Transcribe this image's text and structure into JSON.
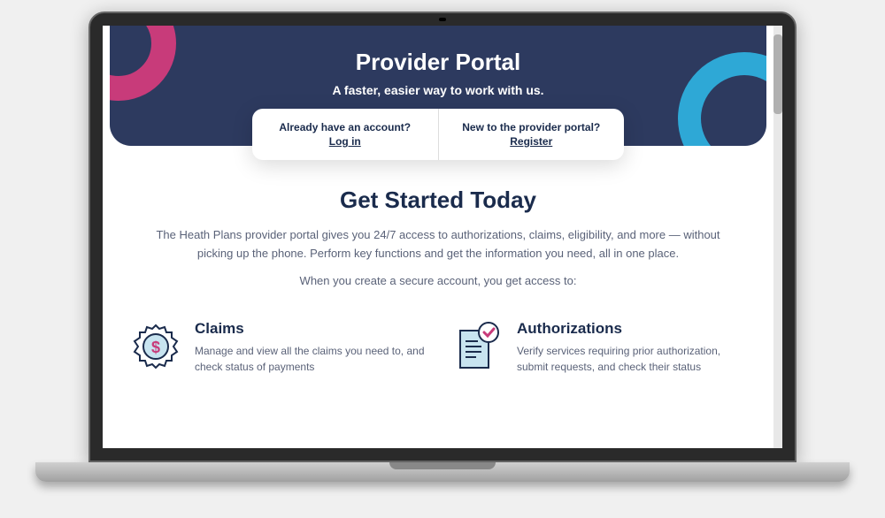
{
  "hero": {
    "title": "Provider Portal",
    "subtitle": "A faster, easier way to work with us."
  },
  "cta": {
    "login": {
      "prompt": "Already have an account?",
      "action": "Log in"
    },
    "register": {
      "prompt": "New to the provider portal?",
      "action": "Register"
    }
  },
  "intro": {
    "heading": "Get Started Today",
    "body": "The Heath Plans provider portal gives you 24/7 access to authorizations, claims, eligibility, and more — without picking up the phone. Perform key functions and get the information you need, all in one place.",
    "lead": "When you create a secure account, you get access to:"
  },
  "features": [
    {
      "title": "Claims",
      "desc": "Manage and view all the claims you need to, and check status of payments"
    },
    {
      "title": "Authorizations",
      "desc": "Verify services requiring prior authorization, submit requests, and check their status"
    }
  ],
  "colors": {
    "navy": "#2d3a5f",
    "pink": "#c83b7a",
    "blue": "#2ea8d6"
  }
}
